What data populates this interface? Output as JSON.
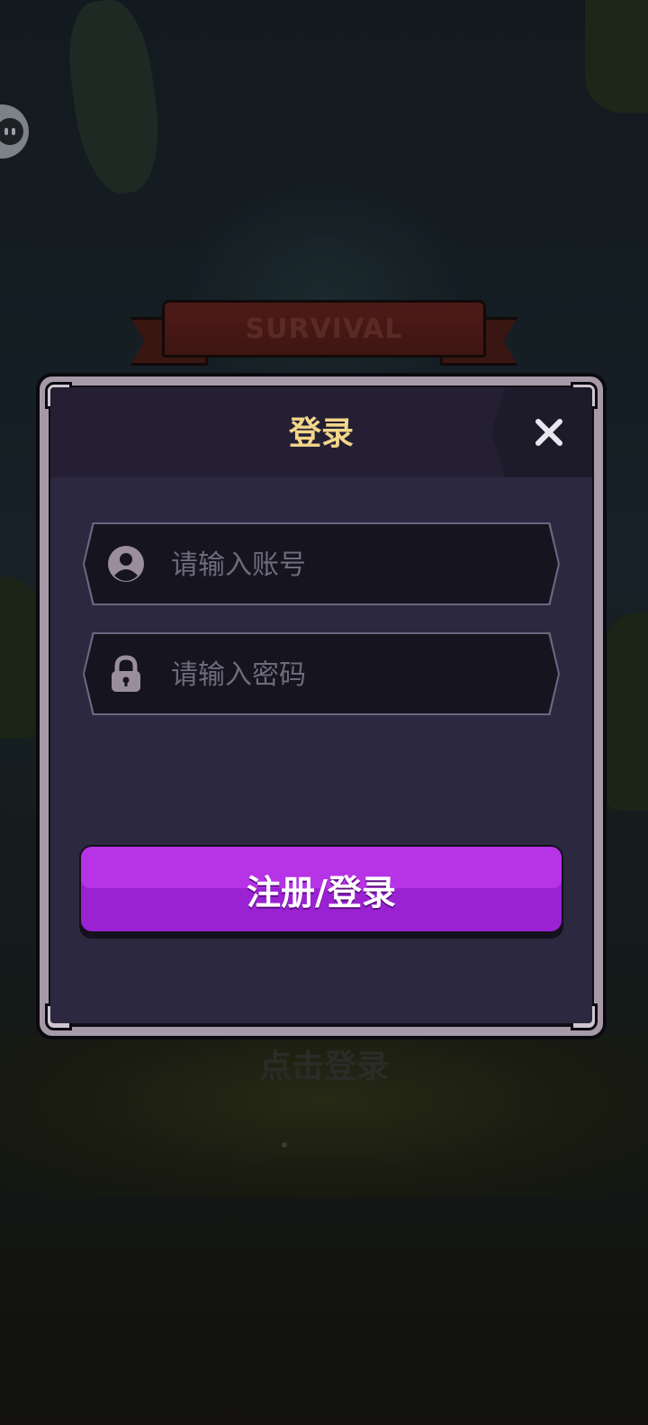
{
  "background": {
    "banner_text": "SURVIVAL",
    "tap_to_login": "点击登录"
  },
  "dialog": {
    "title": "登录",
    "close_icon": "close-icon",
    "account_input": {
      "placeholder": "请输入账号",
      "value": "",
      "icon": "user-icon"
    },
    "password_input": {
      "placeholder": "请输入密码",
      "value": "",
      "icon": "lock-icon"
    },
    "submit_label": "注册/登录"
  },
  "colors": {
    "accent_purple": "#9a22d2",
    "title_gold": "#f3d68a",
    "panel": "#2c2840"
  }
}
